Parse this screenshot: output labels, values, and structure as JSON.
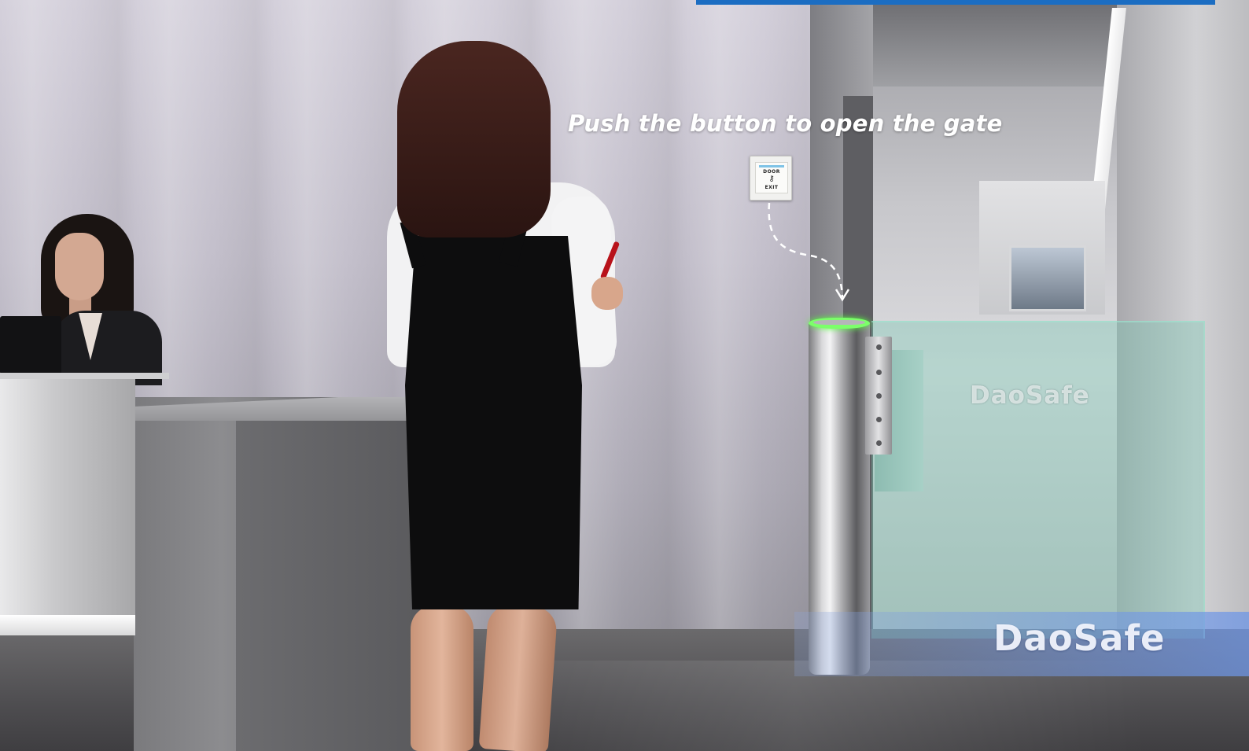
{
  "caption": "Push the button to open the gate",
  "exit_button": {
    "line1": "DOOR",
    "line2": "EXIT",
    "icon": "key-icon"
  },
  "watermarks": {
    "glass": "DaoSafe",
    "footer": "DaoSafe"
  },
  "colors": {
    "accent_bar": "#1b6dc2",
    "status_ring": "#7cff6a",
    "glass_tint": "#78c8b4",
    "caption_text": "#ffffff"
  }
}
